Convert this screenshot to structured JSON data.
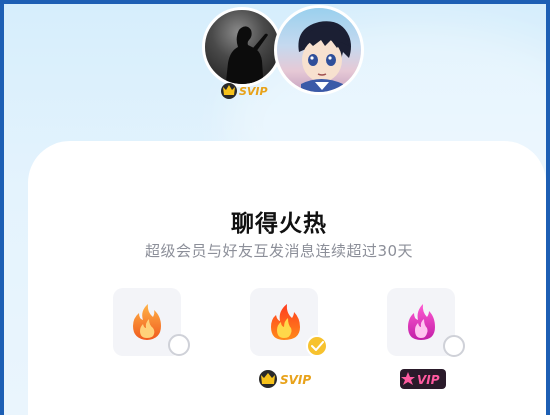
{
  "avatars": {
    "left_name": "silhouette avatar",
    "right_name": "anime character avatar",
    "badge_label": "SVIP"
  },
  "card": {
    "title": "聊得火热",
    "subtitle": "超级会员与好友互发消息连续超过30天"
  },
  "options": [
    {
      "name": "orange-flame",
      "selected": false,
      "tag": ""
    },
    {
      "name": "red-flame",
      "selected": true,
      "tag": "SVIP"
    },
    {
      "name": "pink-flame",
      "selected": false,
      "tag": "VIP"
    }
  ],
  "colors": {
    "accent_gold": "#f7c22e",
    "svip_text": "#e8a21a",
    "vip_text": "#ff5aa0",
    "background": "#dff1fc"
  },
  "icons": [
    "flame-icon",
    "check-icon",
    "svip-badge-icon",
    "vip-badge-icon"
  ]
}
